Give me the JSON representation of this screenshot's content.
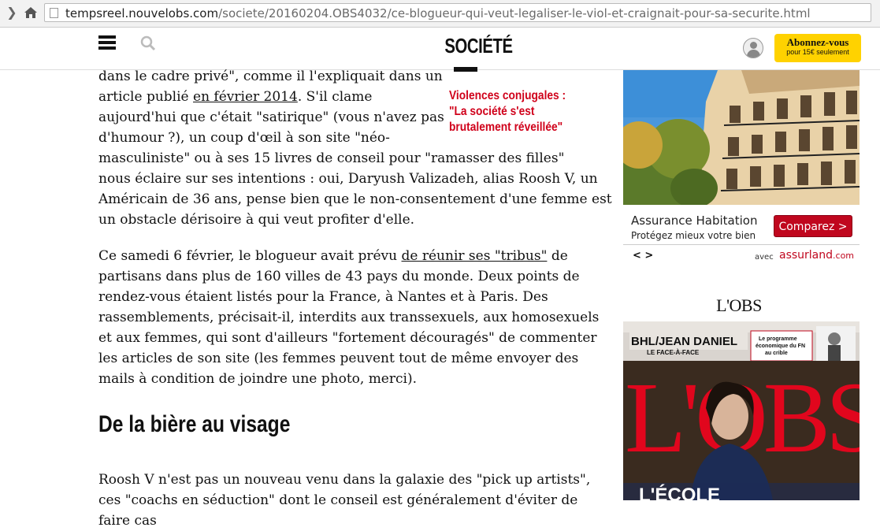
{
  "browser": {
    "url_domain": "tempsreel.nouvelobs.com",
    "url_path": "/societe/20160204.OBS4032/ce-blogueur-qui-veut-legaliser-le-viol-et-craignait-pour-sa-securite.html"
  },
  "header": {
    "section_title": "SOCIÉTÉ",
    "subscribe_label": "Abonnez-vous",
    "subscribe_sub": "pour 15€ seulement"
  },
  "article": {
    "p1_lines": [
      "dans le cadre privé\", comme il l'expliquait dans un",
      "article publié ",
      "en février 2014",
      ". S'il clame",
      "aujourd'hui que c'était \"satirique\" (vous n'avez pas",
      "d'humour ?), un coup d'œil à son site \"néo-",
      "masculiniste\" ou à ses 15 livres de conseil pour \"ramasser des filles\"",
      "nous éclaire sur ses intentions : oui, Daryush Valizadeh, alias Roosh V, un",
      "Américain de 36 ans, pense bien que le non-consentement d'une femme est",
      "un obstacle dérisoire à qui veut profiter d'elle."
    ],
    "p2_a": "Ce samedi 6 février, le blogueur avait prévu ",
    "p2_link": "de réunir ses \"tribus\"",
    "p2_b": " de partisans dans plus de 160 villes de 43 pays du monde. Deux points de rendez-vous étaient listés pour la France, à Nantes et à Paris. Des rassemblements, précisait-il, interdits aux transsexuels, aux homosexuels et aux femmes, qui sont d'ailleurs \"fortement découragés\" de commenter les articles de son site (les femmes peuvent tout de même envoyer des mails à condition de joindre une photo, merci).",
    "subhead": "De la bière au visage",
    "p3": "Roosh V n'est pas un nouveau venu dans la galaxie des \"pick up artists\", ces \"coachs en séduction\" dont le conseil est généralement d'éviter de faire cas"
  },
  "related": {
    "title": "Violences conjugales : \"La société s'est brutalement réveillée\""
  },
  "ad": {
    "title": "Assurance Habitation",
    "subtitle": "Protégez mieux votre bien",
    "button": "Comparez >",
    "arrows": "< >",
    "avec": "avec",
    "brand": "assurland",
    "brand_suffix": ".com"
  },
  "magazine": {
    "logo": "L'OBS",
    "cover_headline": "BHL/JEAN DANIEL",
    "cover_sub": "LE FACE-À-FACE",
    "cover_box": "Le programme économique du FN au crible",
    "cover_title": "L'OBS",
    "cover_bottom": "L'ÉCOLE"
  },
  "colors": {
    "accent_red": "#d0021b",
    "subscribe_yellow": "#ffd200",
    "ad_red": "#c0071e"
  }
}
